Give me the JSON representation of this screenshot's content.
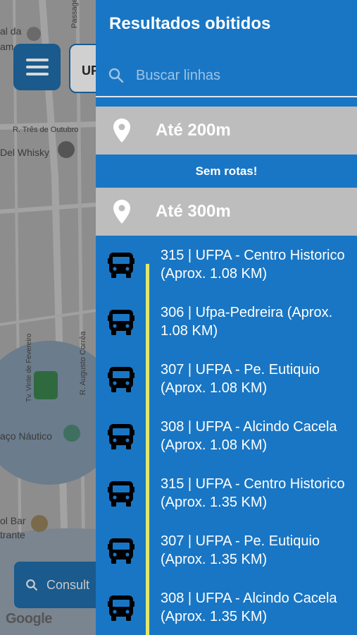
{
  "map": {
    "labels": {
      "top_left": "al da",
      "top_left2": "am",
      "street_tres": "R. Três de Outubro",
      "whisky": "Del Whisky",
      "augusto": "R. Augusto Corrêa",
      "fevereiro": "Tv. Vinte de Fevereiro",
      "nautico": "aço Náutico",
      "bar": "ol Bar",
      "rante": "trante",
      "passagem": "Passagem Ar"
    },
    "chip_text": "UF",
    "consult_label": "Consult",
    "google": "Google"
  },
  "drawer": {
    "title": "Resultados obitidos",
    "search_placeholder": "Buscar linhas",
    "sections": [
      {
        "label": "Até 200m"
      },
      {
        "label": "Até 300m"
      }
    ],
    "empty_message": "Sem rotas!",
    "routes": [
      "315 | UFPA - Centro Historico (Aprox. 1.08 KM)",
      "306 | Ufpa-Pedreira (Aprox. 1.08 KM)",
      "307 | UFPA - Pe. Eutiquio (Aprox. 1.08 KM)",
      "308 | UFPA - Alcindo Cacela (Aprox. 1.08 KM)",
      "315 | UFPA - Centro Historico (Aprox. 1.35 KM)",
      "307 | UFPA - Pe. Eutiquio (Aprox. 1.35 KM)",
      "308 | UFPA - Alcindo Cacela (Aprox. 1.35 KM)"
    ]
  },
  "colors": {
    "drawer_bg": "#1976c4",
    "section_bg": "#bdbdbd",
    "timeline": "#e2e86a",
    "menu_button": "#1a5a8c"
  }
}
